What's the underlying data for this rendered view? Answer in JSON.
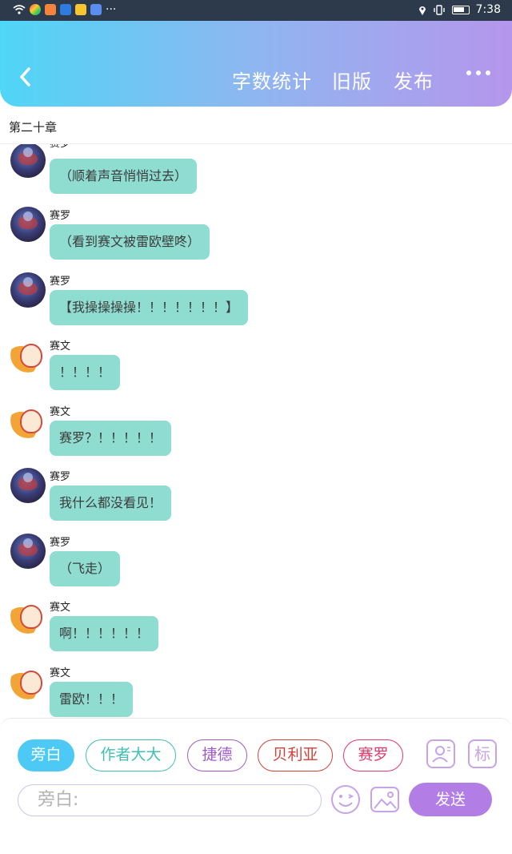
{
  "status_bar": {
    "time": "7:38",
    "more_dots": "···"
  },
  "header": {
    "word_count": "字数统计",
    "old_version": "旧版",
    "publish": "发布"
  },
  "chapter": {
    "title": "第二十章"
  },
  "messages": [
    {
      "name": "赛罗",
      "text": "（顺着声音悄悄过去）",
      "avatar": "zero-avatar"
    },
    {
      "name": "赛罗",
      "text": "（看到赛文被雷欧壁咚）",
      "avatar": "zero-avatar"
    },
    {
      "name": "赛罗",
      "text": "【我操操操操！！！！！！！】",
      "avatar": "zero-avatar"
    },
    {
      "name": "赛文",
      "text": "！！！！",
      "avatar": "seven-avatar"
    },
    {
      "name": "赛文",
      "text": "赛罗？！！！！！",
      "avatar": "seven-avatar"
    },
    {
      "name": "赛罗",
      "text": "我什么都没看见！",
      "avatar": "zero-avatar"
    },
    {
      "name": "赛罗",
      "text": "（飞走）",
      "avatar": "zero-avatar"
    },
    {
      "name": "赛文",
      "text": "啊！！！！！！",
      "avatar": "seven-avatar"
    },
    {
      "name": "赛文",
      "text": "雷欧！！！",
      "avatar": "seven-avatar"
    }
  ],
  "roles": [
    {
      "label": "旁白",
      "active": true,
      "color": "#4cc9f4"
    },
    {
      "label": "作者大大",
      "active": false,
      "color": "#3fbfb4"
    },
    {
      "label": "捷德",
      "active": false,
      "color": "#a05ac8"
    },
    {
      "label": "贝利亚",
      "active": false,
      "color": "#d2403a"
    },
    {
      "label": "赛罗",
      "active": false,
      "color": "#e03a6c"
    }
  ],
  "tools": {
    "contact_icon": "person-card-icon",
    "mark_label": "标"
  },
  "composer": {
    "placeholder": "旁白:",
    "send_label": "发送"
  },
  "colors": {
    "bubble": "#8fdcd1",
    "send": "#b27ee6",
    "accent": "#4cc9f4"
  }
}
